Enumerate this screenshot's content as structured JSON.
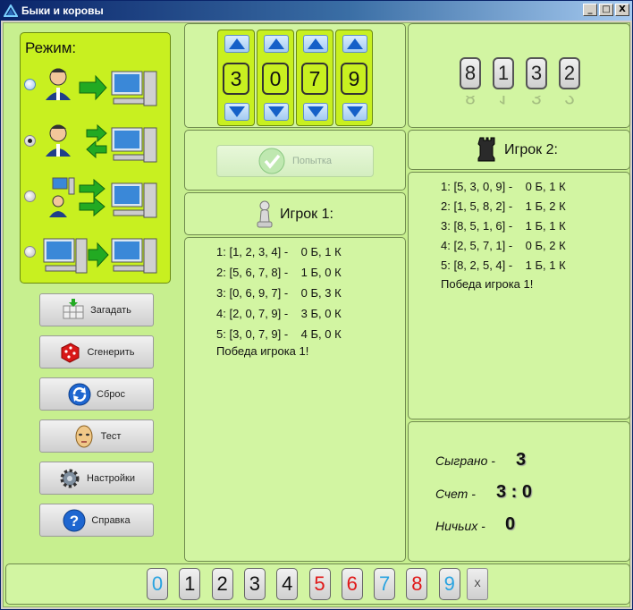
{
  "window": {
    "title": "Быки и коровы",
    "minimize": "_",
    "maximize": "□",
    "close": "X"
  },
  "mode": {
    "title": "Режим:",
    "options": [
      {
        "name": "player-vs-computer",
        "selected": false
      },
      {
        "name": "player-and-computer",
        "selected": true
      },
      {
        "name": "player-computer-vs-computer",
        "selected": false
      },
      {
        "name": "computer-vs-computer",
        "selected": false
      }
    ]
  },
  "buttons": {
    "guess": "Загадать",
    "generate": "Сгенерить",
    "reset": "Сброс",
    "test": "Тест",
    "settings": "Настройки",
    "help": "Справка",
    "attempt": "Попытка",
    "clear": "X"
  },
  "spinner_digits": [
    "3",
    "0",
    "7",
    "9"
  ],
  "secret_digits": [
    "8",
    "1",
    "3",
    "2"
  ],
  "player1": {
    "title": "Игрок 1:",
    "lines": [
      "1: [1, 2, 3, 4] -    0 Б, 1 К",
      "2: [5, 6, 7, 8] -    1 Б, 0 К",
      "3: [0, 6, 9, 7] -    0 Б, 3 К",
      "4: [2, 0, 7, 9] -    3 Б, 0 К",
      "5: [3, 0, 7, 9] -    4 Б, 0 К"
    ],
    "result": "Победа игрока 1!"
  },
  "player2": {
    "title": "Игрок 2:",
    "lines": [
      "1: [5, 3, 0, 9] -    0 Б, 1 К",
      "2: [1, 5, 8, 2] -    1 Б, 2 К",
      "3: [8, 5, 1, 6] -    1 Б, 1 К",
      "4: [2, 5, 7, 1] -    0 Б, 2 К",
      "5: [8, 2, 5, 4] -    1 Б, 1 К"
    ],
    "result": "Победа игрока 1!"
  },
  "stats": {
    "played_label": "Сыграно -",
    "played_value": "3",
    "score_label": "Счет -",
    "score_value": "3 : 0",
    "draws_label": "Ничьих -",
    "draws_value": "0"
  },
  "digit_keys": [
    {
      "d": "0",
      "color": "#29a3e0"
    },
    {
      "d": "1",
      "color": "#111111"
    },
    {
      "d": "2",
      "color": "#111111"
    },
    {
      "d": "3",
      "color": "#111111"
    },
    {
      "d": "4",
      "color": "#111111"
    },
    {
      "d": "5",
      "color": "#e01818"
    },
    {
      "d": "6",
      "color": "#e01818"
    },
    {
      "d": "7",
      "color": "#29a3e0"
    },
    {
      "d": "8",
      "color": "#e01818"
    },
    {
      "d": "9",
      "color": "#29a3e0"
    }
  ]
}
